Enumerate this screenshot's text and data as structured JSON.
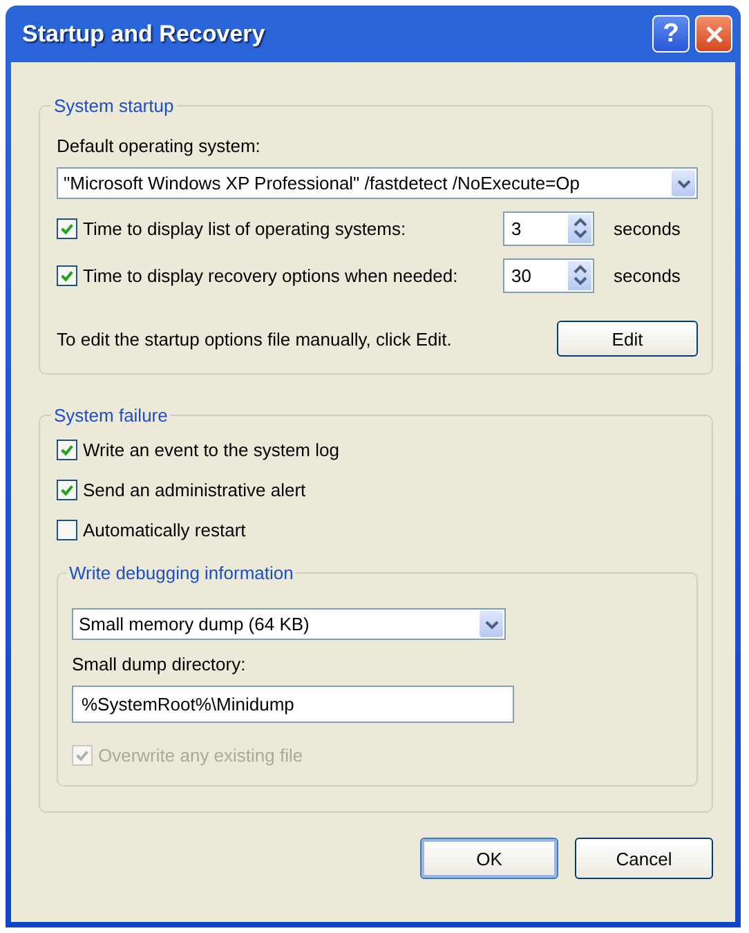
{
  "window": {
    "title": "Startup and Recovery",
    "help": "?"
  },
  "system_startup": {
    "title": "System startup",
    "default_os_label": "Default operating system:",
    "default_os": "\"Microsoft Windows XP Professional\" /fastdetect /NoExecute=Op",
    "timers": [
      {
        "label": "Time to display list of operating systems:",
        "checked": true,
        "value": "3",
        "unit": "seconds"
      },
      {
        "label": "Time to display recovery options when needed:",
        "checked": true,
        "value": "30",
        "unit": "seconds"
      }
    ],
    "edit_note": "To edit the startup options file manually, click Edit.",
    "edit_button": "Edit"
  },
  "system_failure": {
    "title": "System failure",
    "options": [
      {
        "label": "Write an event to the system log",
        "checked": true
      },
      {
        "label": "Send an administrative alert",
        "checked": true
      },
      {
        "label": "Automatically restart",
        "checked": false
      }
    ],
    "debugging": {
      "title": "Write debugging information",
      "dump_type": "Small memory dump (64 KB)",
      "directory_label": "Small dump directory:",
      "directory": "%SystemRoot%\\Minidump",
      "overwrite": {
        "label": "Overwrite any existing file",
        "checked": true,
        "disabled": true
      }
    }
  },
  "buttons": [
    "OK",
    "Cancel"
  ]
}
